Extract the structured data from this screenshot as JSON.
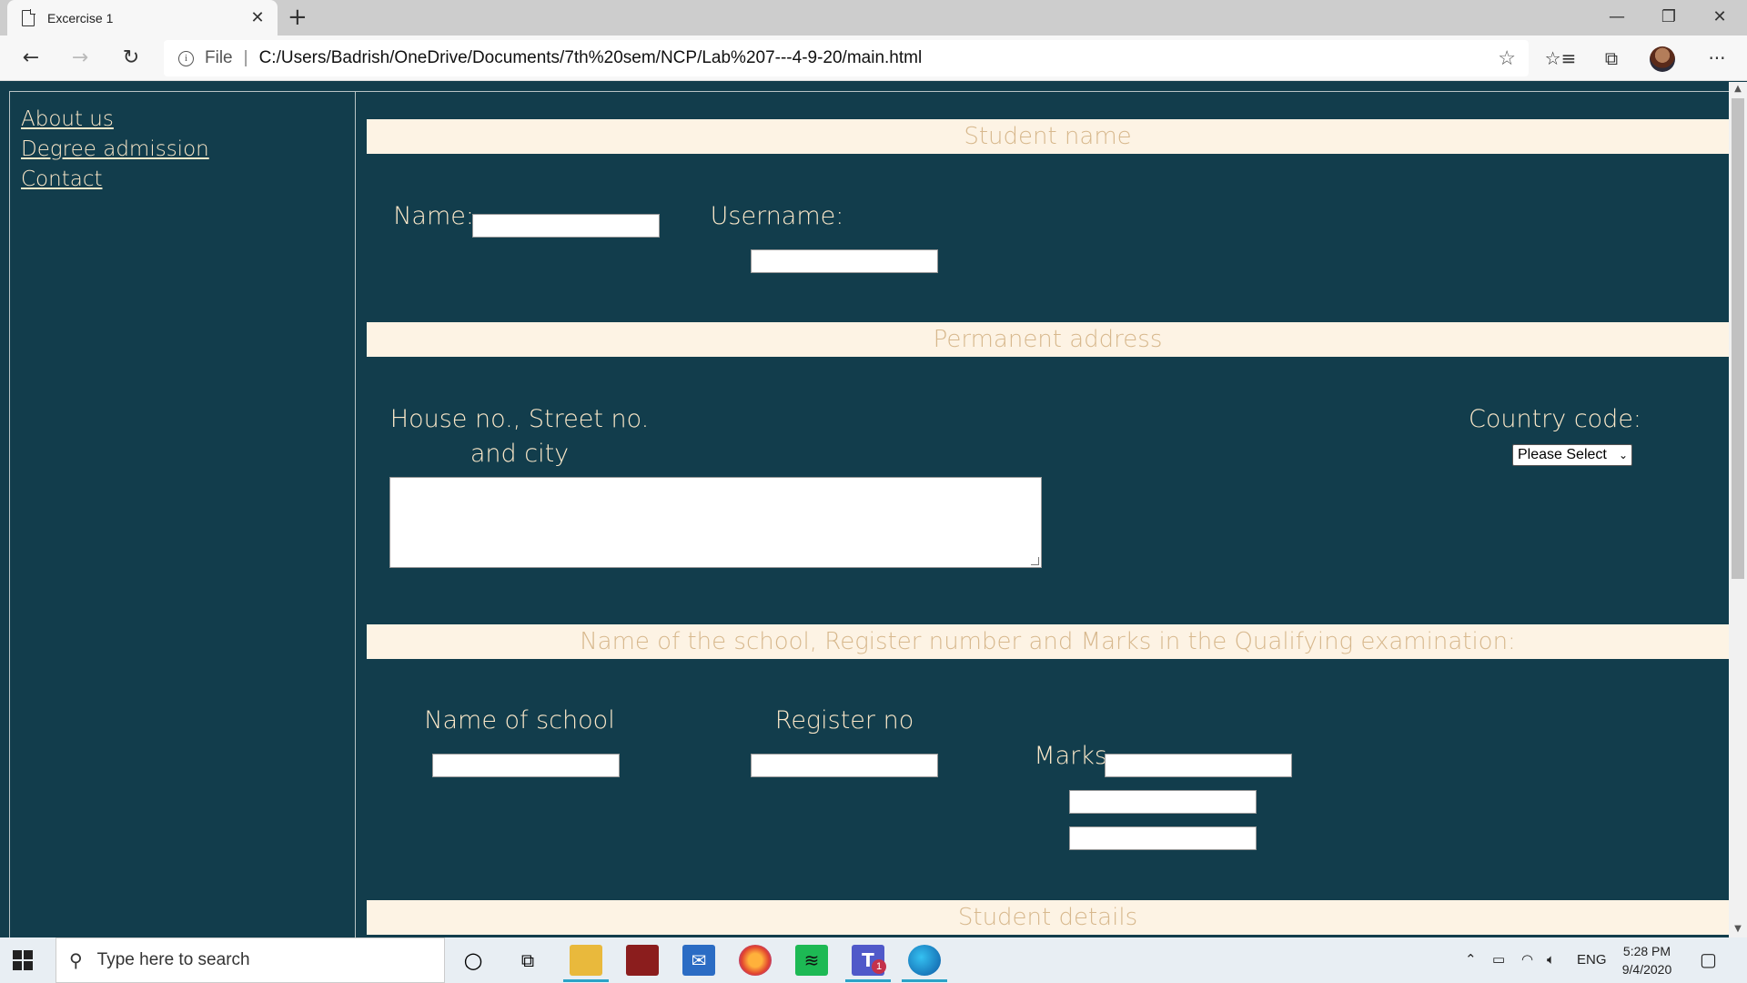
{
  "browser": {
    "tab_title": "Excercise 1",
    "file_label": "File",
    "url": "C:/Users/Badrish/OneDrive/Documents/7th%20sem/NCP/Lab%207---4-9-20/main.html"
  },
  "sidebar": {
    "links": [
      "About us",
      "Degree admission",
      "Contact"
    ]
  },
  "form": {
    "student_name_header": "Student name",
    "name_label": "Name:",
    "username_label": "Username:",
    "address_header": "Permanent address",
    "house_label_line1": "House no., Street no.",
    "house_label_line2": "and city",
    "country_code_label": "Country code:",
    "country_code_selected": "Please Select",
    "school_header": "Name of the school, Register number and Marks in the Qualifying examination:",
    "school_label": "Name of school",
    "register_label": "Register no",
    "marks_label": "Marks",
    "student_details_header": "Student details"
  },
  "taskbar": {
    "search_placeholder": "Type here to search",
    "language": "ENG",
    "time": "5:28 PM",
    "date": "9/4/2020",
    "teams_badge": "1"
  },
  "icons": [
    "page-icon",
    "close-icon",
    "plus-icon",
    "minimize-icon",
    "restore-icon",
    "back-arrow-icon",
    "forward-arrow-icon",
    "refresh-icon",
    "info-icon",
    "star-icon",
    "favorites-icon",
    "collections-icon",
    "more-icon",
    "windows-logo-icon",
    "search-icon",
    "cortana-icon",
    "task-view-icon",
    "file-explorer-icon",
    "mail-icon",
    "firefox-icon",
    "spotify-icon",
    "teams-icon",
    "edge-icon",
    "chevron-up-icon",
    "battery-icon",
    "wifi-icon",
    "volume-icon",
    "notification-icon"
  ]
}
